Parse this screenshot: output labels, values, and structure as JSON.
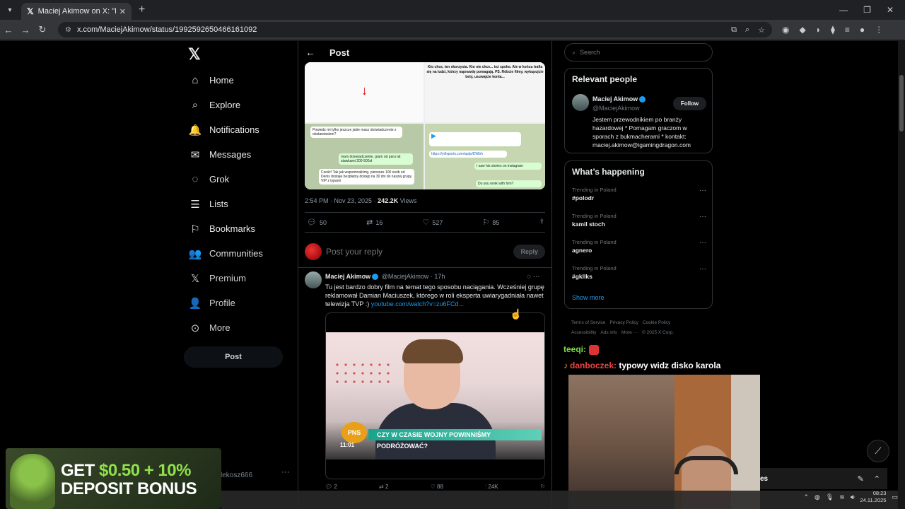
{
  "browser": {
    "tab_title": "Maciej Akimow on X: \"Denis Za",
    "url": "x.com/MaciejAkimow/status/1992592650466161092"
  },
  "nav": {
    "items": [
      {
        "label": "Home",
        "icon": "home-icon",
        "glyph": "⌂"
      },
      {
        "label": "Explore",
        "icon": "search-icon",
        "glyph": "⌕"
      },
      {
        "label": "Notifications",
        "icon": "bell-icon",
        "glyph": "🔔"
      },
      {
        "label": "Messages",
        "icon": "envelope-icon",
        "glyph": "✉"
      },
      {
        "label": "Grok",
        "icon": "grok-icon",
        "glyph": "◌"
      },
      {
        "label": "Lists",
        "icon": "list-icon",
        "glyph": "☰"
      },
      {
        "label": "Bookmarks",
        "icon": "bookmark-icon",
        "glyph": "⚐"
      },
      {
        "label": "Communities",
        "icon": "people-icon",
        "glyph": "👥"
      },
      {
        "label": "Premium",
        "icon": "x-logo-icon",
        "glyph": "𝕏"
      },
      {
        "label": "Profile",
        "icon": "person-icon",
        "glyph": "👤"
      },
      {
        "label": "More",
        "icon": "more-circle-icon",
        "glyph": "⊙"
      }
    ],
    "post_label": "Post",
    "account_handle": "lekosz666"
  },
  "main": {
    "header_title": "Post",
    "post_time": "2:54 PM · Nov 23, 2025 · ",
    "views_count": "242.2K",
    "views_label": "Views",
    "stats": {
      "replies": "50",
      "reposts": "16",
      "likes": "527",
      "bookmarks": "85"
    },
    "reply_placeholder": "Post your reply",
    "reply_button": "Reply",
    "media_texts": {
      "right_top": "Kto chce, ten skorzysta. Kto nie chce... też spoko. Ale w końcu trafia się na ludzi, którzy naprawdę pomagają. PS. Róbcie filmy, wykupujcie bety, usuwajcie konta...",
      "bubble_left_1": "Powiedz mi tylko jeszcze jakie masz doświadczenie z obstawianiem?",
      "bubble_left_2": "mam doswiadczenie, gram od paru lat stawkami 200-500zł",
      "bubble_left_3": "Cześć! Tak jak wspominaliśmy, pierwsze 100 osób od Denis dostaje bezpłatny dostęp na 30 dni do naszej grupy VIP z typami",
      "bubble_right_link": "https://yrllsports.com/apijs/DWbh",
      "bubble_right_1": "I saw his stories on instagram",
      "bubble_right_2": "Do you work with him?"
    },
    "reply_tweet": {
      "name": "Maciej Akimow",
      "handle_time": "@MaciejAkimow · 17h",
      "text": "Tu jest bardzo dobry film na temat tego sposobu naciągania. Wcześniej grupę reklamował Damian Maciuszek, którego w roli eksperta uwiarygadniała nawet telewizja TVP :) ",
      "link": "youtube.com/watch?v=zu6FCd...",
      "video_caption": "CZY W CZASIE WOJNY POWINNIŚMY PODRÓŻOWAĆ?",
      "video_logo": "PNS",
      "video_time": "11:01",
      "stats": {
        "replies": "2",
        "reposts": "2",
        "likes": "88",
        "views": "24K"
      }
    }
  },
  "right": {
    "search_placeholder": "Search",
    "relevant_title": "Relevant people",
    "person": {
      "name": "Maciej Akimow",
      "handle": "@MaciejAkimow",
      "follow": "Follow",
      "bio": "Jestem przewodnikiem po branży hazardowej * Pomagam graczom w sporach z bukmacherami * kontakt: maciej.akimow@igamingdragon.com"
    },
    "happening_title": "What’s happening",
    "trends": [
      {
        "context": "Trending in Poland",
        "topic": "#polodr"
      },
      {
        "context": "Trending in Poland",
        "topic": "kamil stoch"
      },
      {
        "context": "Trending in Poland",
        "topic": "agnero"
      },
      {
        "context": "Trending in Poland",
        "topic": "#gkllks"
      }
    ],
    "show_more": "Show more",
    "footer": [
      "Terms of Service",
      "Privacy Policy",
      "Cookie Policy",
      "Accessibility",
      "Ads info",
      "More ···",
      "© 2025 X Corp."
    ]
  },
  "stream": {
    "chat1_user": "teeqi:",
    "chat2_user": "danboczek:",
    "chat2_msg": " typowy widz disko karola",
    "promo_line1_white": "GET ",
    "promo_line1_green": "$0.50 + 10%",
    "promo_line2": "DEPOSIT BONUS",
    "panel_text": "es"
  },
  "taskbar": {
    "time": "08:23",
    "date": "24.11.2025"
  },
  "colors": {
    "accent": "#1d9bf0",
    "chat_green": "#7ddc4b",
    "chat_red": "#e44"
  }
}
